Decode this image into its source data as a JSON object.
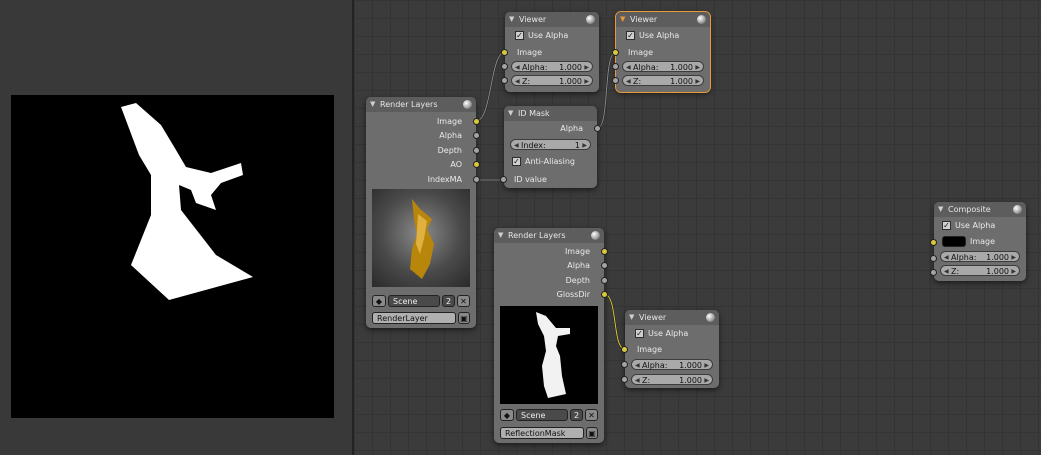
{
  "nodes": {
    "viewer1": {
      "title": "Viewer",
      "use_alpha": "Use Alpha",
      "image": "Image",
      "alpha_label": "Alpha:",
      "alpha_value": "1.000",
      "z_label": "Z:",
      "z_value": "1.000"
    },
    "viewer2": {
      "title": "Viewer",
      "use_alpha": "Use Alpha",
      "image": "Image",
      "alpha_label": "Alpha:",
      "alpha_value": "1.000",
      "z_label": "Z:",
      "z_value": "1.000"
    },
    "render1": {
      "title": "Render Layers",
      "outputs": [
        "Image",
        "Alpha",
        "Depth",
        "AO",
        "IndexMA"
      ],
      "scene": "Scene",
      "scene_count": "2",
      "layer": "RenderLayer"
    },
    "idmask": {
      "title": "ID Mask",
      "alpha": "Alpha",
      "index_label": "Index:",
      "index_value": "1",
      "anti_aliasing": "Anti-Aliasing",
      "id_value": "ID value"
    },
    "render2": {
      "title": "Render Layers",
      "outputs": [
        "Image",
        "Alpha",
        "Depth",
        "GlossDir"
      ],
      "scene": "Scene",
      "scene_count": "2",
      "layer": "ReflectionMask"
    },
    "viewer3": {
      "title": "Viewer",
      "use_alpha": "Use Alpha",
      "image": "Image",
      "alpha_label": "Alpha:",
      "alpha_value": "1.000",
      "z_label": "Z:",
      "z_value": "1.000"
    },
    "composite": {
      "title": "Composite",
      "use_alpha": "Use Alpha",
      "image": "Image",
      "alpha_label": "Alpha:",
      "alpha_value": "1.000",
      "z_label": "Z:",
      "z_value": "1.000"
    }
  },
  "colors": {
    "editor_bg": "#3b3b3b",
    "socket_image": "#d8c83a",
    "socket_value": "#a3a3a3",
    "active_outline": "#e8993a"
  },
  "icons": [
    "node-collapse-icon",
    "node-preview-icon",
    "scene-icon",
    "close-icon",
    "render-layer-icon"
  ]
}
